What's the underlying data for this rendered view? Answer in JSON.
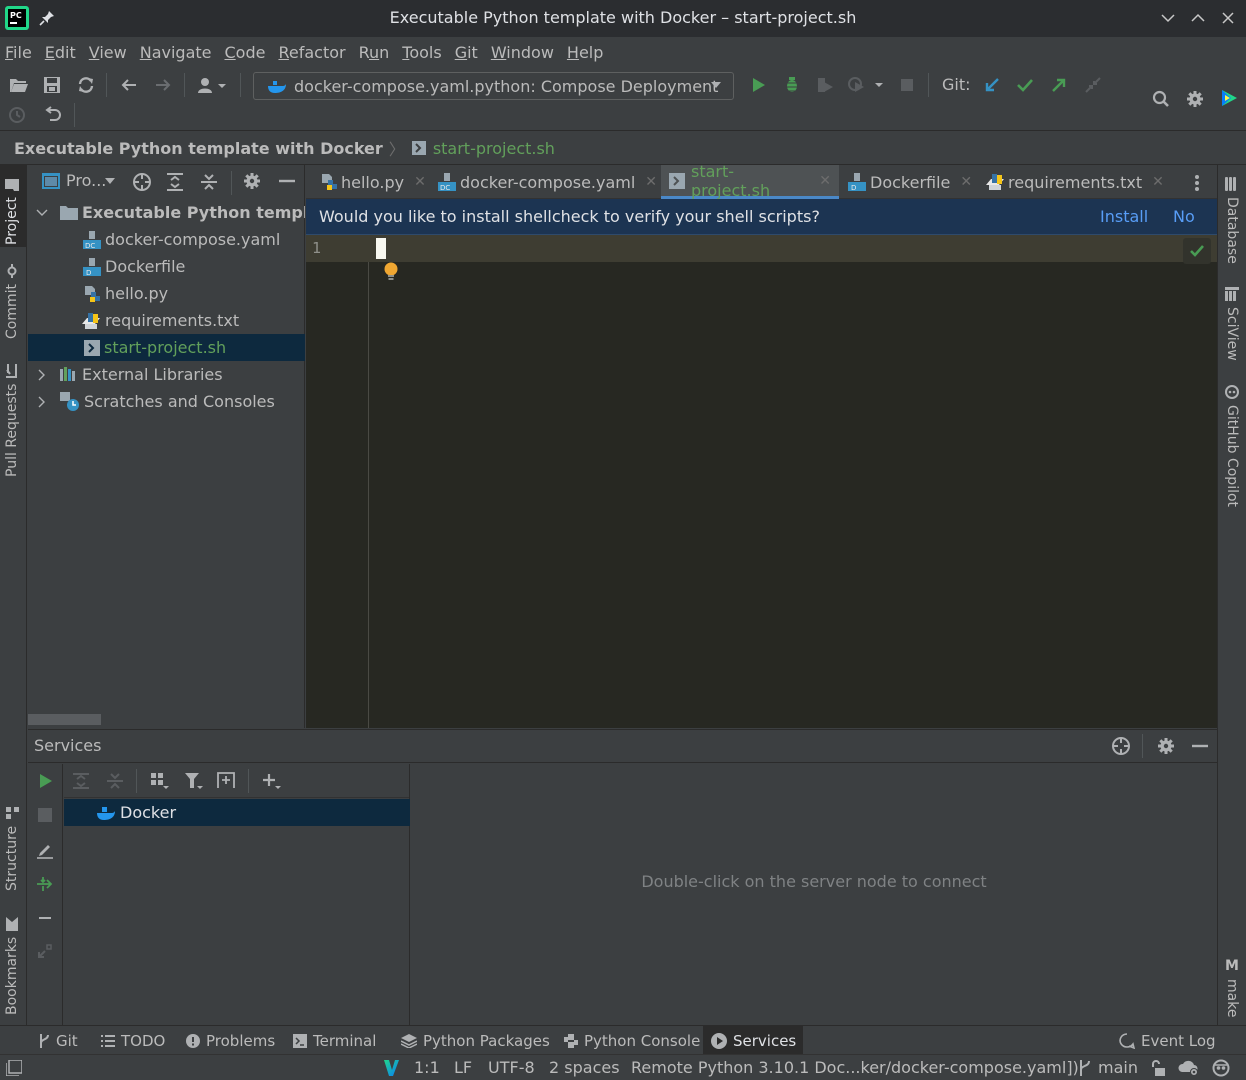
{
  "window": {
    "title": "Executable Python template with Docker – start-project.sh",
    "app_icon": "pycharm-logo-icon",
    "pin_icon": "pin-icon",
    "controls": [
      "minimize",
      "maximize",
      "close"
    ]
  },
  "menu": {
    "items": [
      {
        "label": "File",
        "mnemonic": "F"
      },
      {
        "label": "Edit",
        "mnemonic": "E"
      },
      {
        "label": "View",
        "mnemonic": "V"
      },
      {
        "label": "Navigate",
        "mnemonic": "N"
      },
      {
        "label": "Code",
        "mnemonic": "C"
      },
      {
        "label": "Refactor",
        "mnemonic": "R"
      },
      {
        "label": "Run",
        "mnemonic": "u"
      },
      {
        "label": "Tools",
        "mnemonic": "T"
      },
      {
        "label": "Git",
        "mnemonic": "G"
      },
      {
        "label": "Window",
        "mnemonic": "W"
      },
      {
        "label": "Help",
        "mnemonic": "H"
      }
    ]
  },
  "toolbar": {
    "run_config": "docker-compose.yaml.python: Compose Deployment",
    "git_label": "Git:",
    "icons": [
      "open-folder",
      "save-all",
      "synchronize",
      "back",
      "forward",
      "vcs-user",
      "run",
      "debug",
      "run-with-coverage",
      "profile",
      "stop",
      "git-update",
      "git-commit",
      "git-push",
      "git-rollback",
      "history",
      "revert",
      "search",
      "settings",
      "code-with-me"
    ]
  },
  "breadcrumbs": {
    "root": "Executable Python template with Docker",
    "file": "start-project.sh"
  },
  "left_strip": {
    "items": [
      {
        "label": "Project",
        "active": true
      },
      {
        "label": "Commit"
      },
      {
        "label": "Pull Requests"
      },
      {
        "label": "Structure"
      },
      {
        "label": "Bookmarks"
      }
    ]
  },
  "right_strip": {
    "items": [
      {
        "label": "Database"
      },
      {
        "label": "SciView"
      },
      {
        "label": "GitHub Copilot"
      },
      {
        "label": "make"
      }
    ]
  },
  "project": {
    "view_selector": "Pro...",
    "tree": [
      {
        "label": "Executable Python templa",
        "type": "folder",
        "expanded": true,
        "bold": true
      },
      {
        "label": "docker-compose.yaml",
        "type": "docker-compose"
      },
      {
        "label": "Dockerfile",
        "type": "dockerfile"
      },
      {
        "label": "hello.py",
        "type": "python"
      },
      {
        "label": "requirements.txt",
        "type": "requirements"
      },
      {
        "label": "start-project.sh",
        "type": "shell",
        "selected": true
      },
      {
        "label": "External Libraries",
        "type": "libraries",
        "expanded": false
      },
      {
        "label": "Scratches and Consoles",
        "type": "scratches",
        "expanded": false
      }
    ]
  },
  "editor": {
    "tabs": [
      {
        "label": "hello.py",
        "type": "python"
      },
      {
        "label": "docker-compose.yaml",
        "type": "docker-compose"
      },
      {
        "label": "start-project.sh",
        "type": "shell",
        "active": true
      },
      {
        "label": "Dockerfile",
        "type": "dockerfile"
      },
      {
        "label": "requirements.txt",
        "type": "requirements"
      }
    ],
    "notification": {
      "text": "Would you like to install shellcheck to verify your shell scripts?",
      "install": "Install",
      "no": "No"
    },
    "line_numbers": [
      "1"
    ],
    "content": ""
  },
  "services": {
    "title": "Services",
    "tree": [
      {
        "label": "Docker",
        "selected": true
      }
    ],
    "empty_message": "Double-click on the server node to connect"
  },
  "bottom_tabs": [
    {
      "label": "Git",
      "icon": "branch"
    },
    {
      "label": "TODO",
      "icon": "list"
    },
    {
      "label": "Problems",
      "icon": "warning"
    },
    {
      "label": "Terminal",
      "icon": "terminal"
    },
    {
      "label": "Python Packages",
      "icon": "layers"
    },
    {
      "label": "Python Console",
      "icon": "python"
    },
    {
      "label": "Services",
      "icon": "play-circle",
      "active": true
    },
    {
      "label": "Event Log",
      "icon": "balloon"
    }
  ],
  "status": {
    "position": "1:1",
    "line_ending": "LF",
    "encoding": "UTF-8",
    "indent": "2 spaces",
    "interpreter": "Remote Python 3.10.1 Doc...ker/docker-compose.yaml])",
    "branch": "main"
  },
  "colors": {
    "accent": "#4a88c7",
    "run_green": "#499c54",
    "file_green": "#62a05b",
    "notice_bg": "#1c3452",
    "link_blue": "#589df6",
    "selection": "#0d293e"
  }
}
